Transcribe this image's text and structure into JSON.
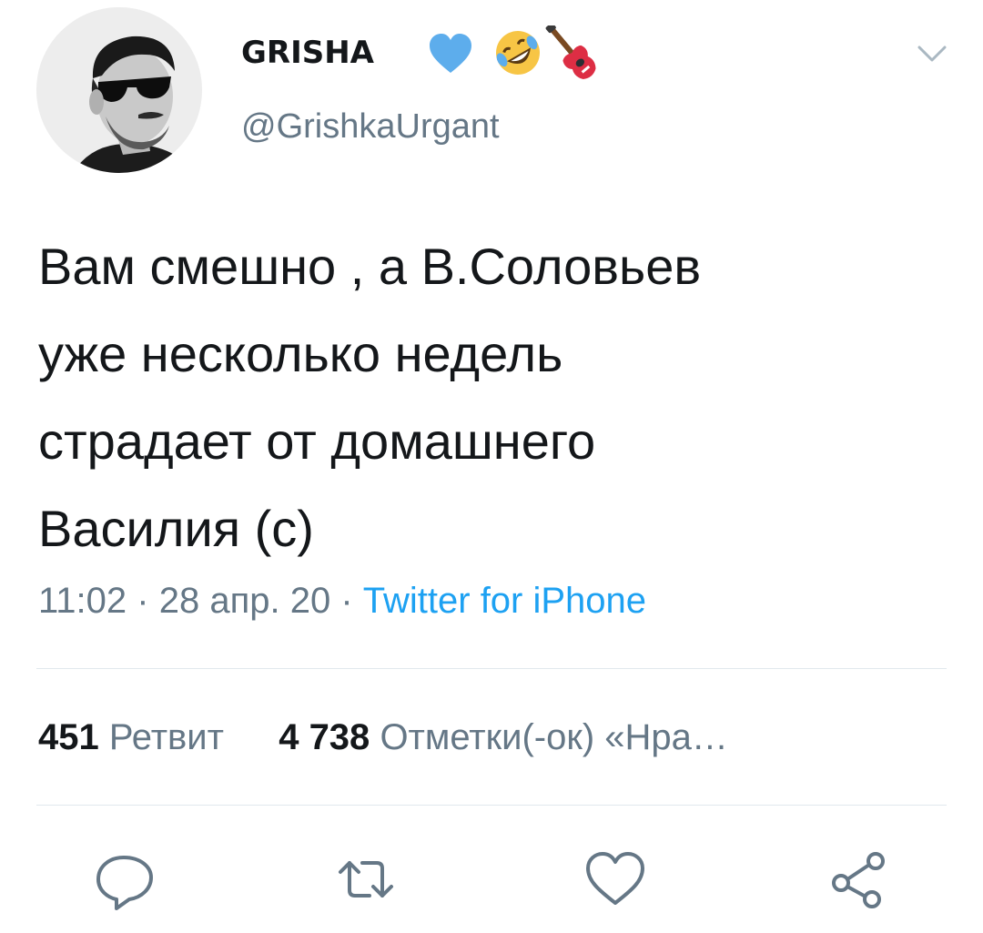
{
  "user": {
    "display_name": "GRISHA",
    "handle": "@GrishkaUrgant",
    "name_emojis": [
      "blue-heart-icon",
      "rolling-on-floor-laughing-icon",
      "guitar-icon"
    ]
  },
  "tweet": {
    "lines": [
      "Вам смешно , а В.Соловьев",
      "уже несколько недель",
      "страдает от домашнего",
      "Василия (с)"
    ],
    "time": "11:02",
    "sep1": "·",
    "date": "28 апр. 20",
    "sep2": "·",
    "source": "Twitter for iPhone"
  },
  "stats": {
    "retweets_count": "451",
    "retweets_label": "Ретвит",
    "likes_count": "4 738",
    "likes_label": "Отметки(-ок) «Нра…"
  },
  "actions": [
    "reply-icon",
    "retweet-icon",
    "like-icon",
    "share-icon"
  ],
  "colors": {
    "text": "#14171a",
    "secondary": "#657786",
    "link": "#1da1f2",
    "divider": "#e1e8ed"
  }
}
